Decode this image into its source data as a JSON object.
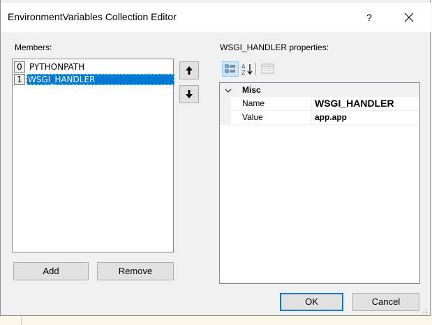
{
  "window": {
    "title": "EnvironmentVariables Collection Editor",
    "help_label": "?",
    "close_label": "✕"
  },
  "members": {
    "label": "Members:",
    "items": [
      {
        "index": "0",
        "name": "PYTHONPATH",
        "selected": false
      },
      {
        "index": "1",
        "name": "WSGI_HANDLER",
        "selected": true
      }
    ],
    "move_up_label": "🠕",
    "move_down_label": "🠗"
  },
  "properties": {
    "label": "WSGI_HANDLER properties:",
    "toolbar": {
      "categorized_icon": "categorized-icon",
      "alphabetical_icon": "alphabetical-icon",
      "property_pages_icon": "property-pages-icon"
    },
    "category": {
      "chevron": "❯",
      "label": "Misc"
    },
    "rows": [
      {
        "name": "Name",
        "value": "WSGI_HANDLER"
      },
      {
        "name": "Value",
        "value": "app.app"
      }
    ]
  },
  "buttons": {
    "add": "Add",
    "remove": "Remove",
    "ok": "OK",
    "cancel": "Cancel"
  }
}
